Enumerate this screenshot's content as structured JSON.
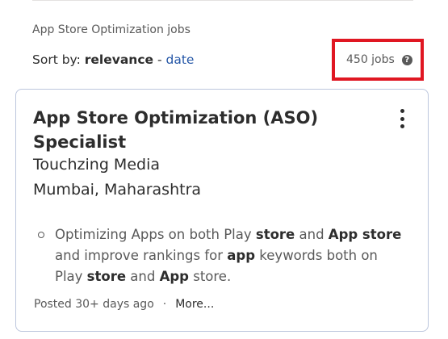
{
  "search_title": "App Store Optimization jobs",
  "sort": {
    "prefix": "Sort by:",
    "active": "relevance",
    "separator": "-",
    "alternative": "date"
  },
  "job_count": "450 jobs",
  "help_icon": "?",
  "job": {
    "title": "App Store Optimization (ASO) Specialist",
    "company": "Touchzing Media",
    "location": "Mumbai, Maharashtra",
    "snippet": {
      "parts": [
        {
          "text": "Optimizing Apps on both Play ",
          "bold": false
        },
        {
          "text": "store",
          "bold": true
        },
        {
          "text": " and ",
          "bold": false
        },
        {
          "text": "App store",
          "bold": true
        },
        {
          "text": " and improve rankings for ",
          "bold": false
        },
        {
          "text": "app",
          "bold": true
        },
        {
          "text": " keywords both on Play ",
          "bold": false
        },
        {
          "text": "store",
          "bold": true
        },
        {
          "text": " and ",
          "bold": false
        },
        {
          "text": "App",
          "bold": true
        },
        {
          "text": " store.",
          "bold": false
        }
      ]
    },
    "posted": "Posted 30+ days ago",
    "footer_separator": "·",
    "more_label": "More..."
  },
  "colors": {
    "link": "#2557a7",
    "highlight_border": "#e01722",
    "card_border": "#bcc6dd"
  }
}
